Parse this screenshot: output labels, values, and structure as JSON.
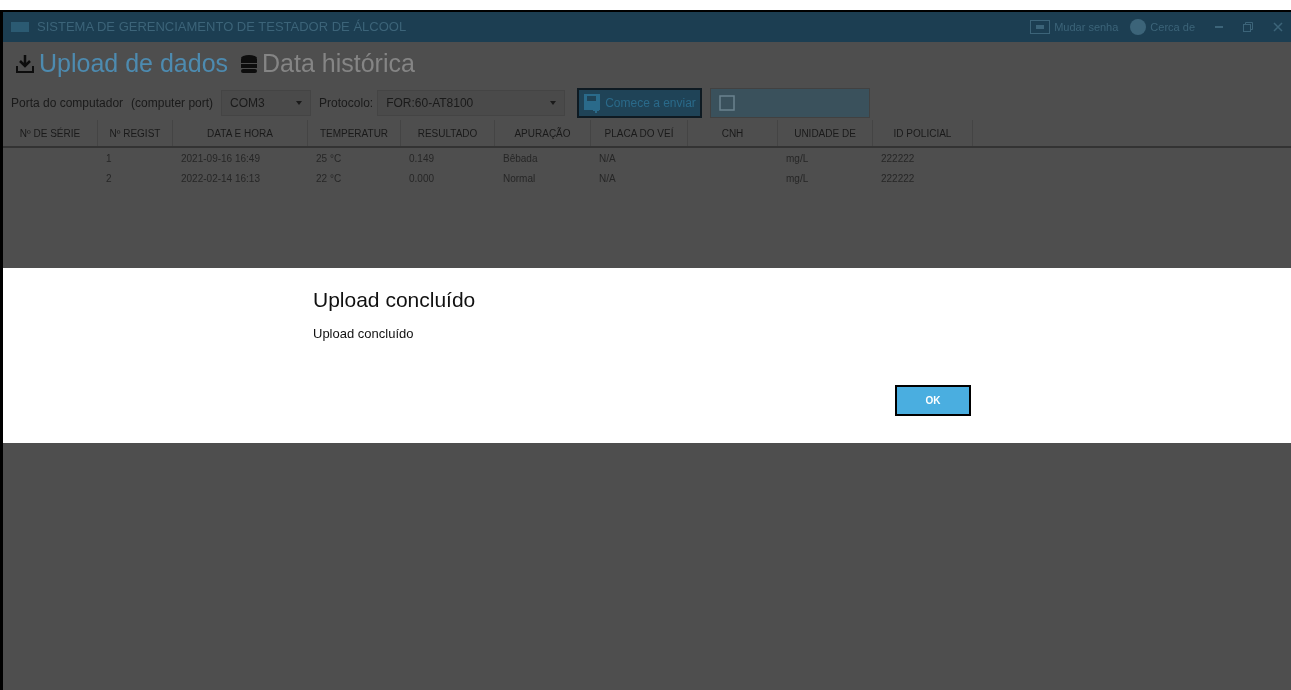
{
  "window": {
    "title": "SISTEMA DE GERENCIAMENTO DE TESTADOR DE ÁLCOOL",
    "actions": [
      "Mudar senha",
      "Cerca de"
    ]
  },
  "tabs": [
    {
      "label": "Upload de dados",
      "selected": true
    },
    {
      "label": "Data histórica",
      "selected": false
    }
  ],
  "toolbar": {
    "port_label": "Porta do computador",
    "port_hint": "(computer port)",
    "port": "COM3",
    "protocol_label": "Protocolo:",
    "protocol": "FOR:60-AT8100",
    "send_button": "Comece a enviar",
    "second_button_disabled": true
  },
  "table": {
    "columns": [
      "Nº DE SÉRIE",
      "Nº REGIST",
      "DATA E HORA",
      "TEMPERATUR",
      "RESULTADO",
      "APURAÇÃO",
      "PLACA DO VEÍ",
      "CNH",
      "UNIDADE DE",
      "ID POLICIAL"
    ],
    "rows": [
      [
        "",
        "1",
        "2021-09-16 16:49",
        "25 °C",
        "0.149",
        "Bêbada",
        "N/A",
        "",
        "mg/L",
        "222222"
      ],
      [
        "",
        "2",
        "2022-02-14 16:13",
        "22 °C",
        "0.000",
        "Normal",
        "N/A",
        "",
        "mg/L",
        "222222"
      ]
    ]
  },
  "dialog": {
    "title": "Upload concluído",
    "message": "Upload concluído",
    "button": "OK"
  }
}
